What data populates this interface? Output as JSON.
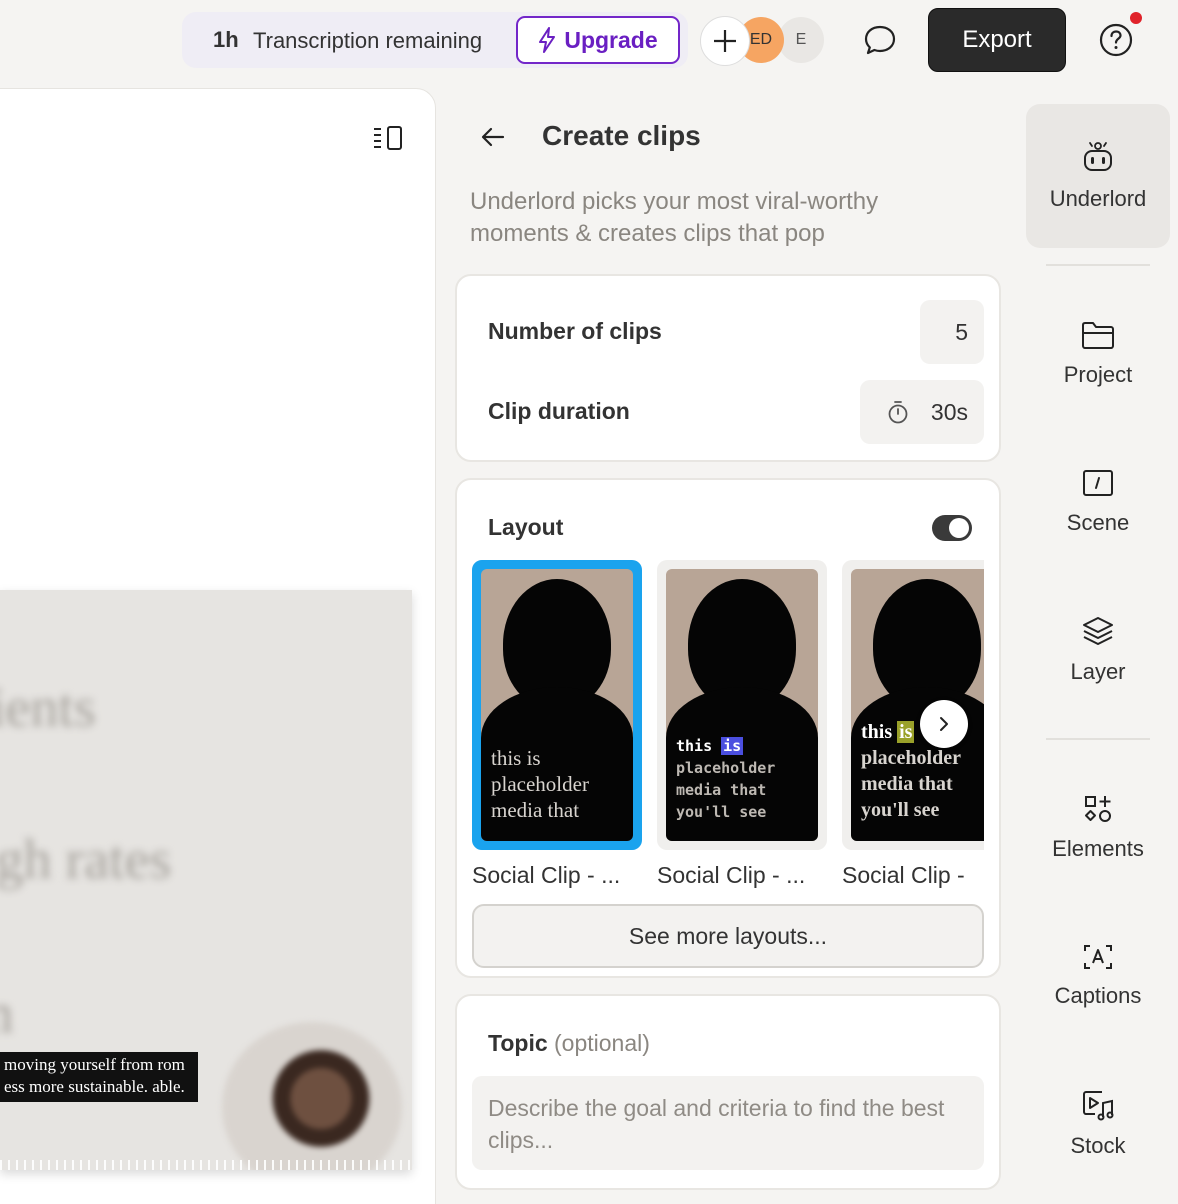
{
  "topbar": {
    "transcription_hours": "1h",
    "transcription_text": "Transcription remaining",
    "upgrade_label": "Upgrade",
    "avatar_ed": "ED",
    "avatar_e": "E",
    "export_label": "Export"
  },
  "canvas": {
    "blur_words": [
      "ients",
      "igh rates",
      "m"
    ],
    "caption_line_1": "moving yourself from rom",
    "caption_line_2": "ess more sustainable. able."
  },
  "panel": {
    "title": "Create clips",
    "subtitle": "Underlord picks your most viral-worthy moments & creates clips that pop",
    "number_of_clips_label": "Number of clips",
    "number_of_clips_value": "5",
    "clip_duration_label": "Clip duration",
    "clip_duration_value": "30s",
    "layout_label": "Layout",
    "layout_enabled": true,
    "layouts": [
      {
        "name": "Social Clip - ...",
        "selected": true
      },
      {
        "name": "Social Clip - ...",
        "selected": false
      },
      {
        "name": "Social Clip -",
        "selected": false
      }
    ],
    "thumb_caption_1": "this is placeholder media that",
    "thumb_caption_2_first": "this",
    "thumb_caption_2_hl": "is",
    "thumb_caption_2_rest": "placeholder media that you'll see",
    "thumb_caption_3_first": "this",
    "thumb_caption_3_hl": "is",
    "thumb_caption_3_rest": "placeholder media that you'll see",
    "see_more_label": "See more layouts...",
    "topic_label": "Topic",
    "topic_optional": "(optional)",
    "topic_placeholder": "Describe the goal and criteria to find the best clips..."
  },
  "rail": {
    "items": [
      {
        "label": "Underlord",
        "icon": "robot-icon"
      },
      {
        "label": "Project",
        "icon": "folder-icon"
      },
      {
        "label": "Scene",
        "icon": "scene-icon"
      },
      {
        "label": "Layer",
        "icon": "layers-icon"
      },
      {
        "label": "Elements",
        "icon": "elements-icon"
      },
      {
        "label": "Captions",
        "icon": "captions-icon"
      },
      {
        "label": "Stock",
        "icon": "stock-media-icon"
      }
    ]
  },
  "colors": {
    "accent_purple": "#6a1fc2",
    "selected_blue": "#1aa3ee",
    "notification_red": "#e0222a",
    "export_bg": "#2a2a2a"
  }
}
